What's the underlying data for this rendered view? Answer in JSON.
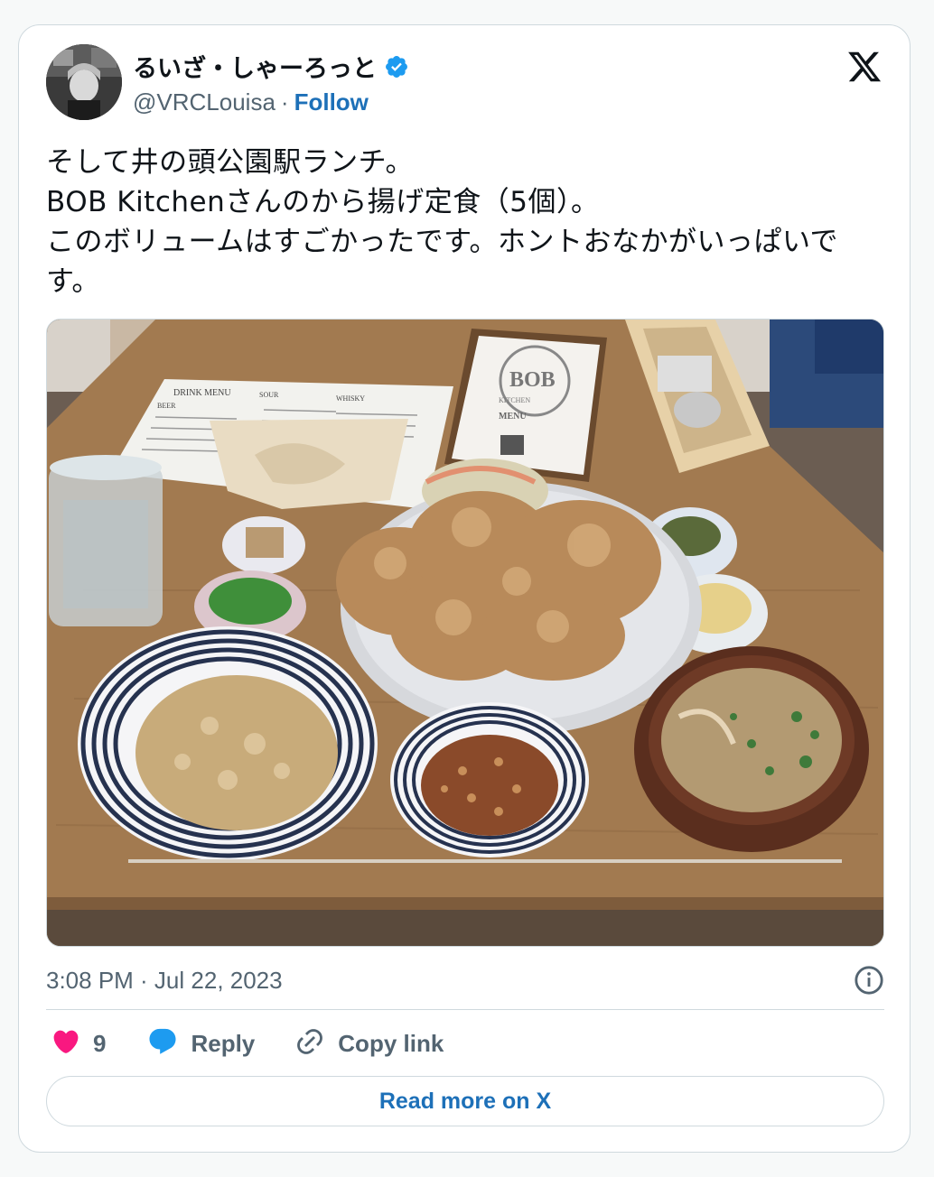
{
  "author": {
    "display_name": "るいざ・しゃーろっと",
    "handle": "@VRCLouisa",
    "separator": "·",
    "follow_label": "Follow",
    "verified": true
  },
  "tweet": {
    "text": "そして井の頭公園駅ランチ。\nBOB Kitchenさんのから揚げ定食（5個）。\nこのボリュームはすごかったです。ホントおなかがいっぱいです。",
    "timestamp": "3:08 PM · Jul 22, 2023"
  },
  "actions": {
    "like_count": "9",
    "reply_label": "Reply",
    "copy_link_label": "Copy link"
  },
  "read_more_label": "Read more on X",
  "colors": {
    "accent": "#1d70b8",
    "like": "#f91880",
    "verified": "#1d9bf0",
    "reply_icon": "#1d9bf0"
  },
  "media": {
    "menu_lines": [
      "DRINK MENU",
      "SOUR",
      "WHISKY",
      "BEER"
    ],
    "bob_card_title": "BOB",
    "bob_card_subtitle": "KITCHEN",
    "bob_card_menu": "MENU"
  }
}
